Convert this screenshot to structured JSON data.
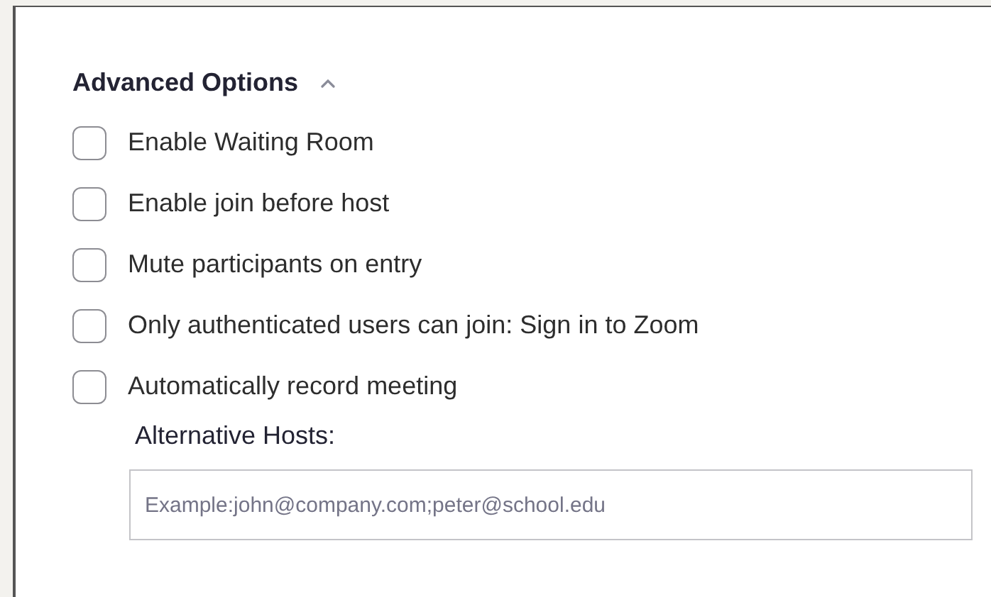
{
  "section": {
    "title": "Advanced Options",
    "expanded": true
  },
  "options": [
    {
      "label": "Enable Waiting Room",
      "checked": false
    },
    {
      "label": "Enable join before host",
      "checked": false
    },
    {
      "label": "Mute participants on entry",
      "checked": false
    },
    {
      "label": "Only authenticated users can join: Sign in to Zoom",
      "checked": false
    },
    {
      "label": "Automatically record meeting",
      "checked": false
    }
  ],
  "alternative_hosts": {
    "label": "Alternative Hosts:",
    "placeholder": "Example:john@company.com;peter@school.edu"
  }
}
